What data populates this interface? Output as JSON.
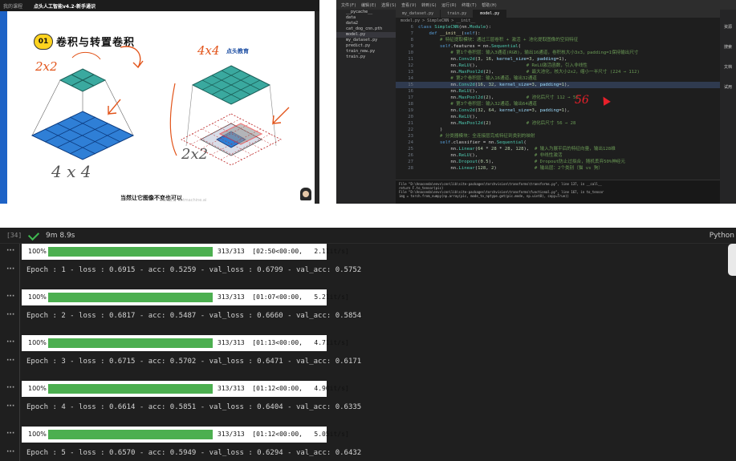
{
  "video": {
    "topbar_link": "我的课程",
    "topbar_title": "点头人工智能v4.2-新手通识",
    "badge": "01",
    "slide_title": "卷积与转置卷积",
    "brand": "点头教育",
    "caption": "当然让它图像不变也可以",
    "watermark": "点头教育 dotmachine.ai",
    "hand_2x2_top": "2x2",
    "hand_4x4_top": "4x4",
    "hand_4x4_bottom": "4 x 4",
    "hand_2x2_bottom": "2x2"
  },
  "ide": {
    "menu": [
      "文件(F)",
      "编辑(E)",
      "选择(S)",
      "查看(V)",
      "转到(G)",
      "运行(R)",
      "终端(T)",
      "帮助(H)"
    ],
    "explorer": [
      "__pycache__",
      "data",
      "data2",
      "cat_dog_cnn.pth",
      "model.py",
      "my_dataset.py",
      "predict.py",
      "train_new.py",
      "train.py"
    ],
    "explorer_selected": 4,
    "tabs": [
      "my_dataset.py",
      "train.py",
      "model.py"
    ],
    "active_tab": 2,
    "breadcrumb": "model.py > SimpleCNN > __init__",
    "code": [
      {
        "n": "6",
        "t": "class SimpleCNN(nn.Module):"
      },
      {
        "n": "7",
        "t": "    def __init__(self):"
      },
      {
        "n": "8",
        "t": "        # 特征提取模块：通过三层卷积 + 激活 + 池化提取图像的空间特征"
      },
      {
        "n": "9",
        "t": "        self.features = nn.Sequential("
      },
      {
        "n": "10",
        "t": "            # 第1个卷积层：输入3通道(RGB)，输出16通道，卷积核大小3x3，padding=1保持输出尺寸"
      },
      {
        "n": "11",
        "t": "            nn.Conv2d(3, 16, kernel_size=3, padding=1),"
      },
      {
        "n": "12",
        "t": "            nn.ReLU(),                  # ReLU激活函数，引入非线性"
      },
      {
        "n": "13",
        "t": "            nn.MaxPool2d(2),            # 最大池化，核大小2x2，缩小一半尺寸 (224 → 112)"
      },
      {
        "n": "14",
        "t": "            # 第2个卷积层：输入16通道，输出32通道"
      },
      {
        "n": "15",
        "t": "            nn.Conv2d(16, 32, kernel_size=3, padding=1),"
      },
      {
        "n": "16",
        "t": "            nn.ReLU(),"
      },
      {
        "n": "17",
        "t": "            nn.MaxPool2d(2),            # 池化后尺寸 112 → 56"
      },
      {
        "n": "18",
        "t": "            # 第3个卷积层：输入32通道，输出64通道"
      },
      {
        "n": "19",
        "t": "            nn.Conv2d(32, 64, kernel_size=3, padding=1),"
      },
      {
        "n": "20",
        "t": "            nn.ReLU(),"
      },
      {
        "n": "21",
        "t": "            nn.MaxPool2d(2)             # 池化后尺寸 56 → 28"
      },
      {
        "n": "22",
        "t": "        )"
      },
      {
        "n": "23",
        "t": "        # 分类器模块：全连接层完成特征到类别的映射"
      },
      {
        "n": "24",
        "t": "        self.classifier = nn.Sequential("
      },
      {
        "n": "25",
        "t": "            nn.Linear(64 * 28 * 28, 128),  # 输入为展平后的特征向量，输出128维"
      },
      {
        "n": "26",
        "t": "            nn.ReLU(),                     # 非线性激活"
      },
      {
        "n": "27",
        "t": "            nn.Dropout(0.5),               # Dropout防止过拟合，随机丢弃50%神经元"
      },
      {
        "n": "28",
        "t": "            nn.Linear(128, 2)              # 输出层：2个类别（猫 vs 狗）"
      }
    ],
    "highlight_line": 15,
    "terminal": [
      "File \"D:\\Anaconda\\envs\\cnn\\lib\\site-packages\\torchvision\\transforms\\transforms.py\", line 137, in __call__",
      "    return F.to_tensor(pic)",
      "File \"D:\\Anaconda\\envs\\cnn\\lib\\site-packages\\torchvision\\transforms\\functional.py\", line 167, in to_tensor",
      "    img = torch.from_numpy(np.array(pic, mode_to_nptype.get(pic.mode, np.uint8), copy=True))"
    ],
    "right_panel": [
      "资源",
      "搜索",
      "文档",
      "试用"
    ],
    "annotation": "56"
  },
  "notebook": {
    "cell_number": "[34]",
    "exec_time": "9m 8.9s",
    "kernel": "Python",
    "epochs": [
      {
        "pct": "100%",
        "progress": 1.0,
        "stats": "313/313  [02:50<00:00,   2.11it/s]",
        "log": "Epoch : 1 - loss : 0.6915 - acc: 0.5259 - val_loss : 0.6799 - val_acc: 0.5752"
      },
      {
        "pct": "100%",
        "progress": 1.0,
        "stats": "313/313  [01:07<00:00,   5.21it/s]",
        "log": "Epoch : 2 - loss : 0.6817 - acc: 0.5487 - val_loss : 0.6660 - val_acc: 0.5854"
      },
      {
        "pct": "100%",
        "progress": 1.0,
        "stats": "313/313  [01:13<00:00,   4.71it/s]",
        "log": "Epoch : 3 - loss : 0.6715 - acc: 0.5702 - val_loss : 0.6471 - val_acc: 0.6171"
      },
      {
        "pct": "100%",
        "progress": 1.0,
        "stats": "313/313  [01:12<00:00,   4.90it/s]",
        "log": "Epoch : 4 - loss : 0.6614 - acc: 0.5851 - val_loss : 0.6404 - val_acc: 0.6335"
      },
      {
        "pct": "100%",
        "progress": 1.0,
        "stats": "313/313  [01:12<00:00,   5.05it/s]",
        "log": "Epoch : 5 - loss : 0.6570 - acc: 0.5949 - val_loss : 0.6294 - val_acc: 0.6432"
      }
    ],
    "colors": {
      "bar": "#4caf50",
      "check": "#3fb950"
    }
  }
}
